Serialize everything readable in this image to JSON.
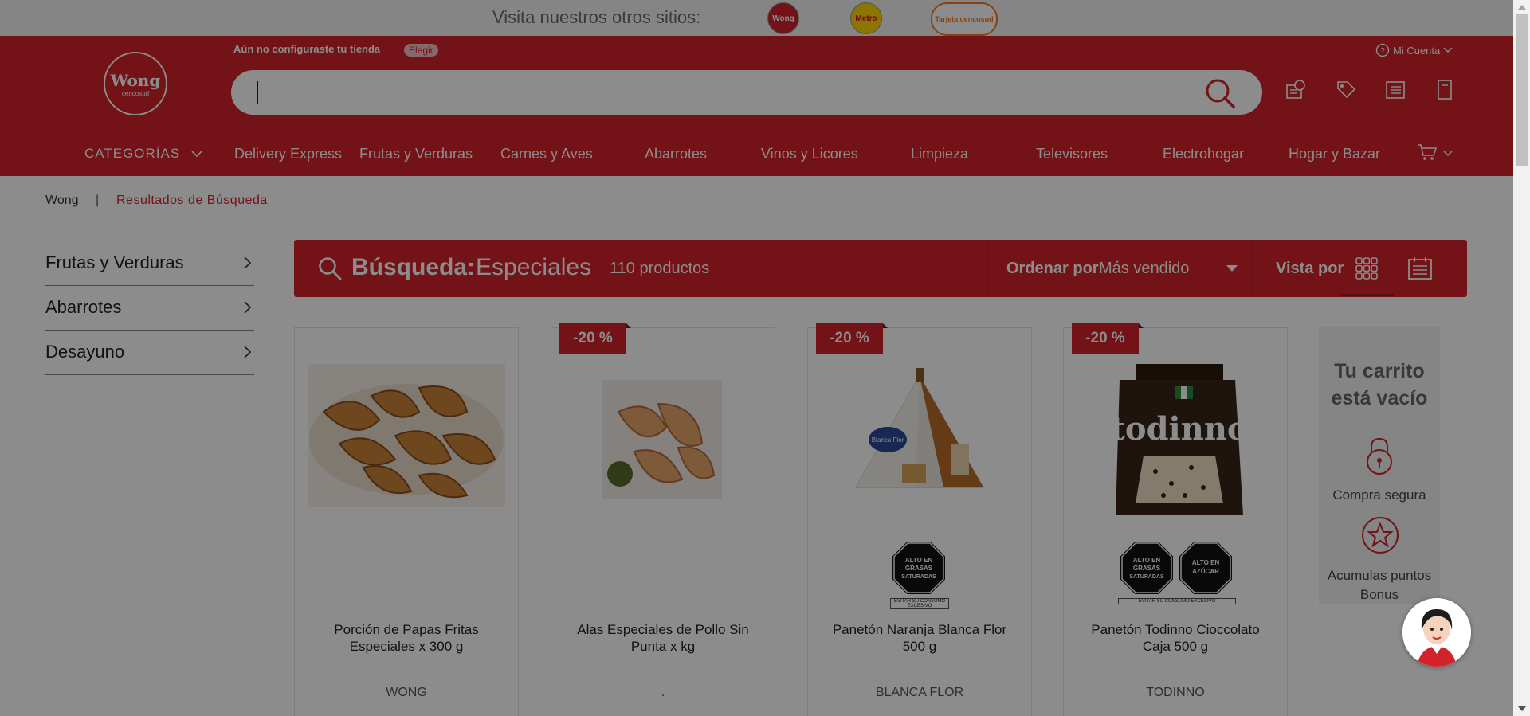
{
  "sites_bar": {
    "text": "Visita nuestros otros sitios:",
    "sites": [
      "Wong",
      "Metro",
      "Tarjeta cencosud"
    ]
  },
  "header": {
    "logo_main": "Wong",
    "logo_sub": "cencosud",
    "store_message": "Aún no configuraste tu tienda",
    "store_button": "Elegir",
    "account_label": "Mi Cuenta",
    "search_value": ""
  },
  "nav": {
    "categories_label": "CATEGORÍAS",
    "items": [
      "Delivery Express",
      "Frutas y Verduras",
      "Carnes y Aves",
      "Abarrotes",
      "Vinos y Licores",
      "Limpieza",
      "Televisores",
      "Electrohogar",
      "Hogar y Bazar"
    ]
  },
  "breadcrumb": {
    "home": "Wong",
    "separator": "|",
    "current": "Resultados de Búsqueda"
  },
  "sidebar": {
    "items": [
      "Frutas y Verduras",
      "Abarrotes",
      "Desayuno"
    ]
  },
  "results": {
    "label": "Búsqueda:",
    "term": "Especiales",
    "count": "110 productos",
    "order_label": "Ordenar por",
    "order_value": "Más vendido",
    "view_label": "Vista por"
  },
  "products": [
    {
      "name": "Porción de Papas Fritas Especiales x 300 g",
      "brand": "WONG",
      "discount": ""
    },
    {
      "name": "Alas Especiales de Pollo Sin Punta x kg",
      "brand": ".",
      "discount": "-20 %"
    },
    {
      "name": "Panetón Naranja Blanca Flor 500 g",
      "brand": "BLANCA FLOR",
      "discount": "-20 %",
      "seals": [
        "ALTO EN GRASAS SATURADAS"
      ]
    },
    {
      "name": "Panetón Todinno Cioccolato Caja 500 g",
      "brand": "TODINNO",
      "discount": "-20 %",
      "seals": [
        "ALTO EN GRASAS SATURADAS",
        "ALTO EN AZÚCAR"
      ]
    }
  ],
  "seal_note": "EVITAR SU CONSUMO EXCESIVO",
  "cart": {
    "title": "Tu carrito está vacío",
    "secure": "Compra segura",
    "bonus": "Acumulas puntos Bonus"
  },
  "colors": {
    "brand_red": "#d2232a",
    "overlay": "rgba(0,0,0,0.45)"
  }
}
